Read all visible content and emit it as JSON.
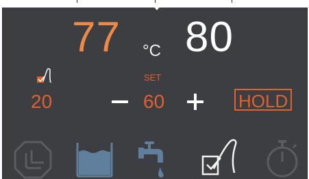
{
  "display": {
    "current_temp": "77",
    "unit": "°C",
    "set_temp": "80",
    "set_label": "SET",
    "probe_value": "20",
    "set_value": "60",
    "hold_label": "HOLD"
  },
  "colors": {
    "panel": "#3d3e42",
    "accent_orange": "#ee8a47",
    "accent_red": "#e0612f",
    "white": "#ffffff",
    "icon_dim": "#5a5c61",
    "water_blue": "#5f7f9c"
  },
  "icons": [
    "probe-status-icon",
    "mode-icon",
    "water-bath-icon",
    "tap-icon",
    "probe-icon",
    "timer-icon"
  ]
}
